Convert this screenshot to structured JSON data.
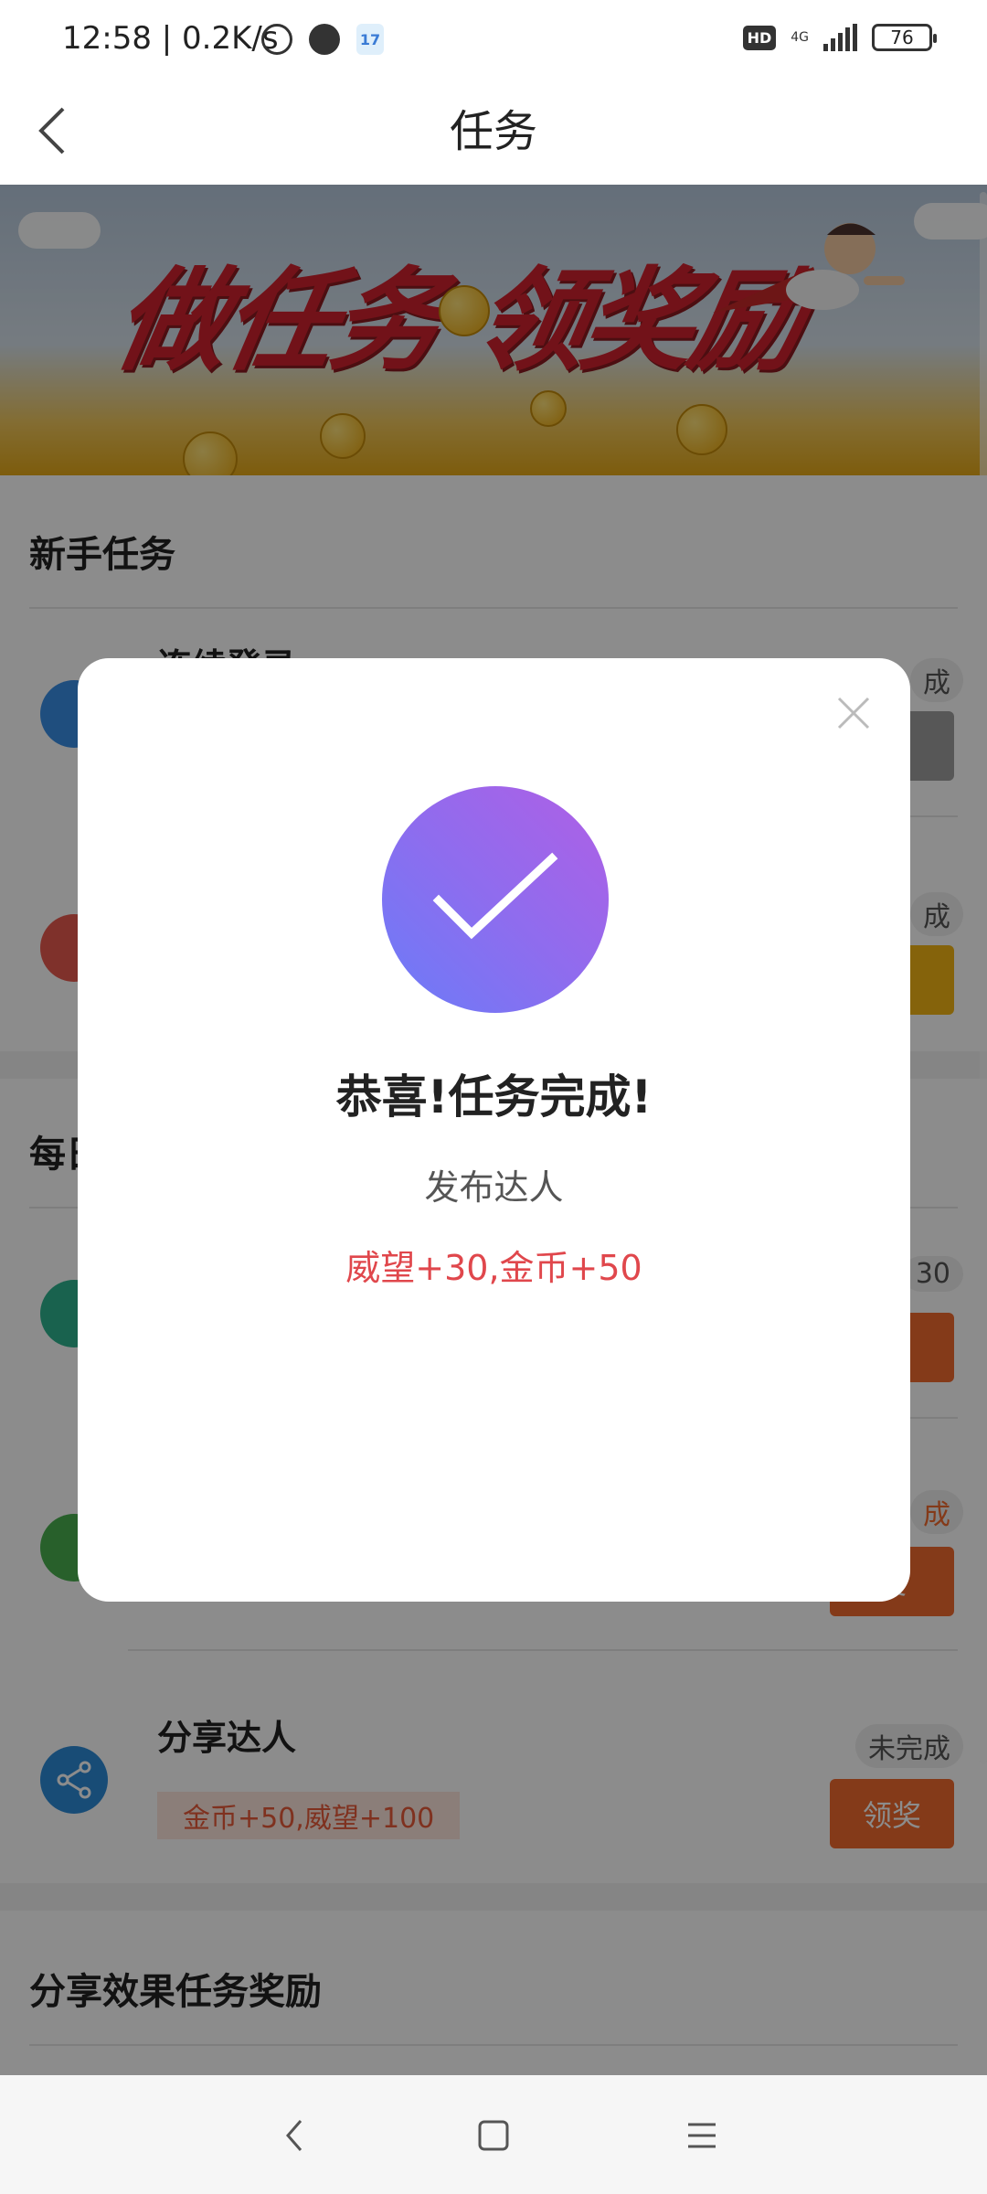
{
  "status_bar": {
    "time_speed": "12:58 | 0.2K/s",
    "calendar_day": "17",
    "hd": "HD",
    "network": "4G",
    "battery": "76"
  },
  "header": {
    "title": "任务"
  },
  "banner": {
    "headline": "做任务 领奖励"
  },
  "sections": {
    "newbie": {
      "title": "新手任务",
      "tasks": [
        {
          "name": "连续登录",
          "status": "成",
          "button": "奖"
        },
        {
          "name": "",
          "status": "成",
          "button": ""
        }
      ]
    },
    "daily": {
      "title": "每日",
      "tasks": [
        {
          "status": "30",
          "button": "奖"
        },
        {
          "status": "成",
          "button": "奖"
        },
        {
          "name": "分享达人",
          "reward": "金币+50,威望+100",
          "status": "未完成",
          "button": "领奖"
        }
      ]
    },
    "share_effect": {
      "title": "分享效果任务奖励"
    }
  },
  "modal": {
    "title": "恭喜!任务完成!",
    "subtitle": "发布达人",
    "reward": "威望+30,金币+50"
  },
  "colors": {
    "accent_orange": "#f06a2f",
    "reward_red": "#e0474c",
    "check_gradient_start": "#6a7cf8",
    "check_gradient_end": "#b05fe5"
  },
  "icons": [
    "alarm-icon",
    "calendar-icon",
    "back-icon",
    "close-icon",
    "check-icon",
    "share-icon",
    "nav-back-icon",
    "nav-home-icon",
    "nav-menu-icon"
  ]
}
